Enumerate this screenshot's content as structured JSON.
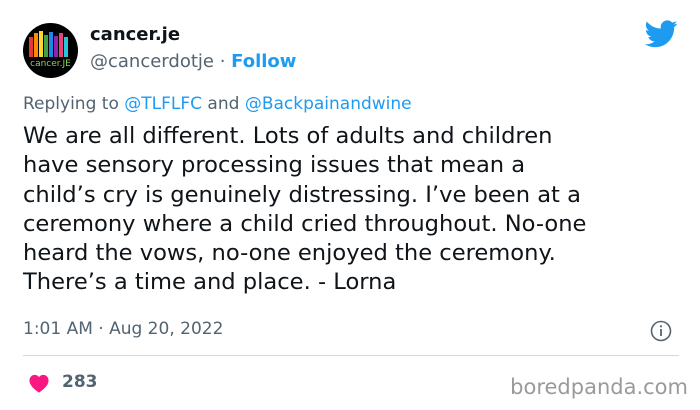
{
  "user": {
    "avatar_text": "cancer.JE",
    "display_name": "cancer.je",
    "handle": "@cancerdotje",
    "separator": " · ",
    "follow_label": "Follow"
  },
  "reply": {
    "prefix": "Replying to ",
    "mention1": "@TLFLFC",
    "and": " and ",
    "mention2": "@Backpainandwine"
  },
  "tweet": {
    "text": "We are all different. Lots of adults and children\nhave sensory processing issues that mean a\nchild’s cry is genuinely distressing. I’ve been at a\nceremony where a child cried throughout. No-one\nheard the vows, no-one enjoyed the ceremony.\nThere’s a time and place. - Lorna",
    "timestamp": "1:01 AM · Aug 20, 2022"
  },
  "engagement": {
    "likes": "283"
  },
  "watermark": "boredpanda.com",
  "icons": [
    "twitter-bird-icon",
    "info-icon",
    "heart-icon"
  ],
  "colors": {
    "accent": "#1d9bf0",
    "text": "#0f1419",
    "secondary": "#536471",
    "heart": "#f91880"
  }
}
